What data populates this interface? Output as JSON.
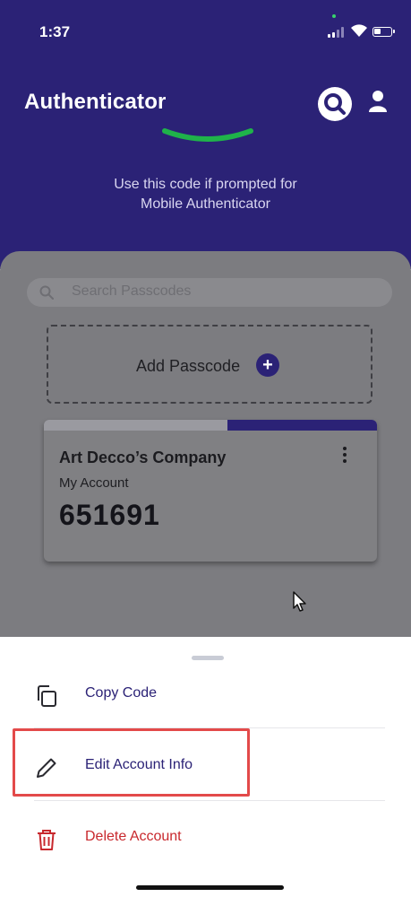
{
  "status_bar": {
    "time": "1:37"
  },
  "header": {
    "title": "Authenticator",
    "prompt_line1": "Use this code if prompted for",
    "prompt_line2": "Mobile Authenticator"
  },
  "search": {
    "placeholder": "Search Passcodes"
  },
  "add_passcode": {
    "label": "Add Passcode"
  },
  "passcode_card": {
    "company": "Art Decco’s Company",
    "account": "My Account",
    "code": "651691",
    "time_remaining_fraction": 0.45
  },
  "sheet": {
    "items": [
      {
        "label": "Copy Code",
        "icon": "copy-icon",
        "color": "#2b2276"
      },
      {
        "label": "Edit Account Info",
        "icon": "pencil-icon",
        "color": "#2b2276"
      },
      {
        "label": "Delete Account",
        "icon": "trash-icon",
        "color": "#c8282d"
      }
    ]
  },
  "colors": {
    "brand": "#2b2276",
    "accent_green": "#1fb34a",
    "danger": "#c8282d",
    "highlight_box": "#e34a4a"
  }
}
